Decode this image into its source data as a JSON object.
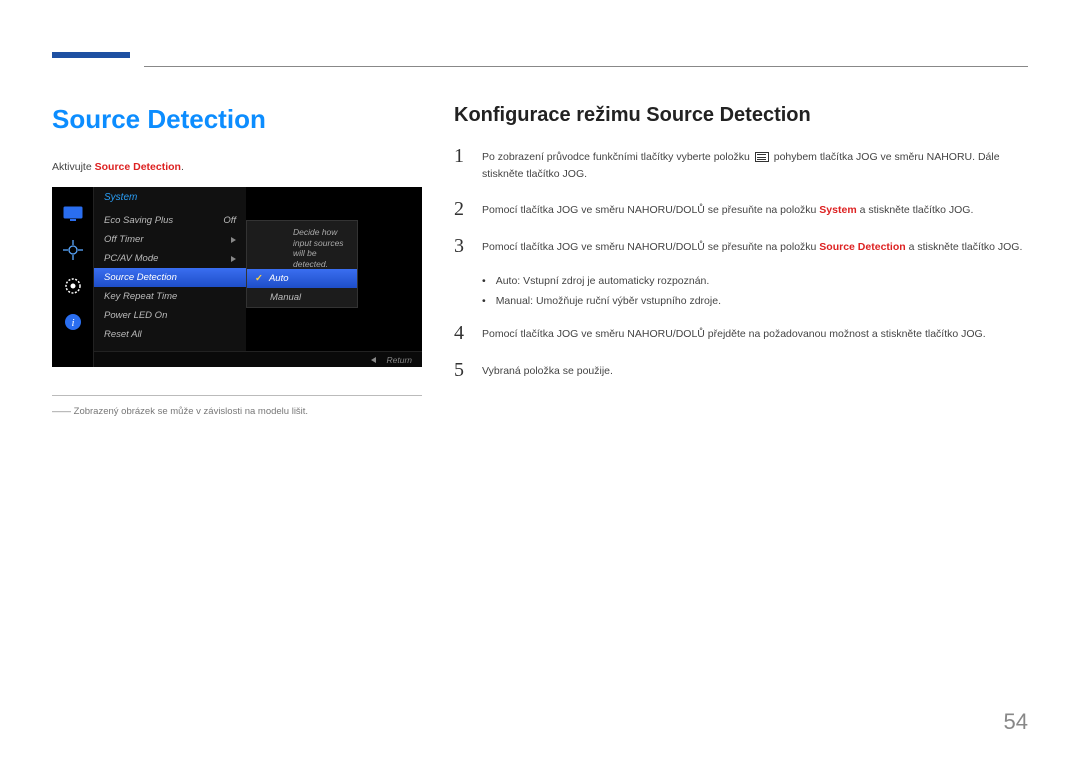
{
  "title": "Source Detection",
  "activate_prefix": "Aktivujte ",
  "activate_bold": "Source Detection",
  "activate_suffix": ".",
  "osd": {
    "header": "System",
    "items": [
      {
        "label": "Eco Saving Plus",
        "value": "Off"
      },
      {
        "label": "Off Timer",
        "value": "▸"
      },
      {
        "label": "PC/AV Mode",
        "value": "▸"
      },
      {
        "label": "Source Detection",
        "value": ""
      },
      {
        "label": "Key Repeat Time",
        "value": ""
      },
      {
        "label": "Power LED On",
        "value": ""
      },
      {
        "label": "Reset All",
        "value": ""
      }
    ],
    "selected_index": 3,
    "submenu": [
      {
        "label": "Auto",
        "selected": true
      },
      {
        "label": "Manual",
        "selected": false
      }
    ],
    "desc": "Decide how input sources will be detected.",
    "footer_return": "Return"
  },
  "footnote": "――   Zobrazený obrázek se může v závislosti na modelu lišit.",
  "subtitle": "Konfigurace režimu Source Detection",
  "steps": {
    "s1a": "Po zobrazení průvodce funkčními tlačítky vyberte položku ",
    "s1b": " pohybem tlačítka JOG ve směru NAHORU. Dále stiskněte tlačítko JOG.",
    "s2a": "Pomocí tlačítka JOG ve směru NAHORU/DOLŮ se přesuňte na položku ",
    "s2_red": "System",
    "s2b": " a stiskněte tlačítko JOG.",
    "s3a": "Pomocí tlačítka JOG ve směru NAHORU/DOLŮ se přesuňte na položku ",
    "s3_red": "Source Detection",
    "s3b": " a stiskněte tlačítko JOG.",
    "b1_red": "Auto",
    "b1": ": Vstupní zdroj je automaticky rozpoznán.",
    "b2_red": "Manual",
    "b2": ": Umožňuje ruční výběr vstupního zdroje.",
    "s4": "Pomocí tlačítka JOG ve směru NAHORU/DOLŮ přejděte na požadovanou možnost a stiskněte tlačítko JOG.",
    "s5": "Vybraná položka se použije."
  },
  "page_number": "54"
}
